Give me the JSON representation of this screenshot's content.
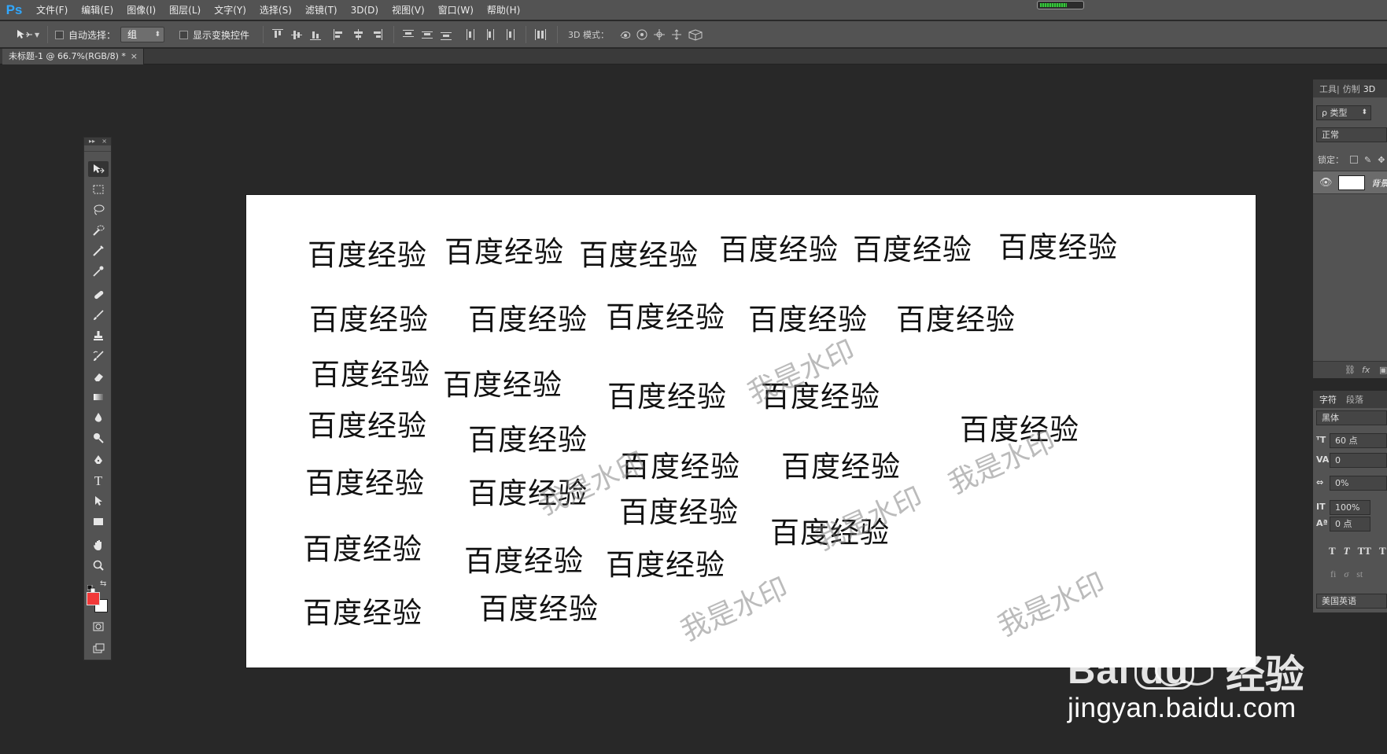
{
  "app": {
    "logo": "Ps"
  },
  "menu": [
    "文件(F)",
    "编辑(E)",
    "图像(I)",
    "图层(L)",
    "文字(Y)",
    "选择(S)",
    "滤镜(T)",
    "3D(D)",
    "视图(V)",
    "窗口(W)",
    "帮助(H)"
  ],
  "options": {
    "auto_select_label": "自动选择：",
    "auto_select_value": "组",
    "show_transform_label": "显示变换控件",
    "mode_3d_label": "3D 模式："
  },
  "document": {
    "tab_title": "未标题-1 @ 66.7%(RGB/8) *",
    "close": "×"
  },
  "toolbox": {
    "tools": [
      "move-tool",
      "marquee-tool",
      "lasso-tool",
      "quick-selection-tool",
      "crop-tool",
      "eyedropper-tool",
      "healing-brush-tool",
      "brush-tool",
      "clone-stamp-tool",
      "history-brush-tool",
      "eraser-tool",
      "gradient-tool",
      "blur-tool",
      "dodge-tool",
      "pen-tool",
      "type-tool",
      "path-selection-tool",
      "rectangle-tool",
      "hand-tool",
      "zoom-tool"
    ],
    "foreground_color": "#f23939",
    "background_color": "#ffffff"
  },
  "canvas": {
    "text_items": [
      "百度经验",
      "百度经验",
      "百度经验",
      "百度经验",
      "百度经验",
      "百度经验",
      "百度经验",
      "百度经验",
      "百度经验",
      "百度经验",
      "百度经验",
      "百度经验",
      "百度经验",
      "百度经验",
      "百度经验",
      "百度经验",
      "百度经验",
      "百度经验",
      "百度经验",
      "百度经验",
      "百度经验",
      "百度经验",
      "百度经验",
      "百度经验",
      "百度经验",
      "百度经验",
      "百度经验",
      "百度经验",
      "百度经验"
    ],
    "watermarks": [
      "我是水印",
      "我是水印",
      "我是水印",
      "我是水印",
      "我是水印",
      "我是水印"
    ]
  },
  "layers_panel": {
    "tabs": [
      "工具|",
      "仿制",
      "3D"
    ],
    "filter_label": "ρ 类型",
    "blend_mode": "正常",
    "lock_label": "锁定：",
    "layer_name": "背景"
  },
  "character_panel": {
    "tabs": [
      "字符",
      "段落"
    ],
    "font_family": "黑体",
    "font_size": "60 点",
    "kerning": "0",
    "tracking": "0%",
    "vertical_scale": "100%",
    "baseline_shift": "0 点",
    "style_buttons": [
      "T",
      "T",
      "TT",
      "T"
    ],
    "opentype_buttons": [
      "fi",
      "σ",
      "st"
    ],
    "language": "美国英语"
  },
  "watermark": {
    "brand_text": "Bai",
    "brand_text2": "du",
    "product": "经验",
    "url": "jingyan.baidu.com"
  }
}
